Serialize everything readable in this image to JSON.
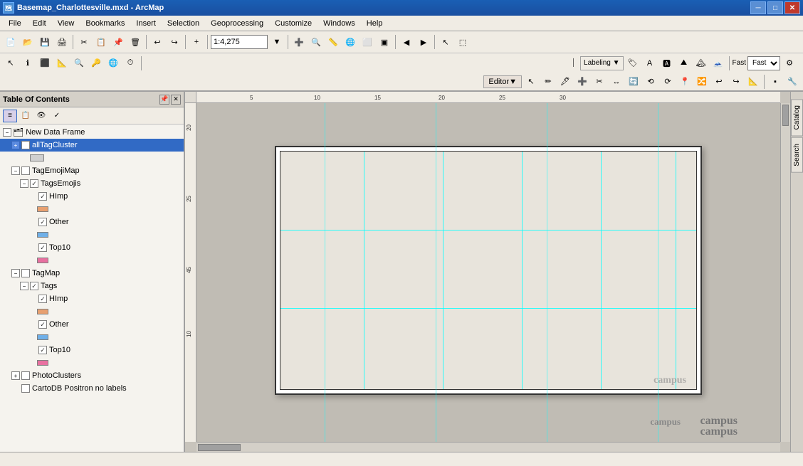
{
  "titleBar": {
    "title": "Basemap_Charlottesville.mxd - ArcMap",
    "minBtn": "─",
    "maxBtn": "□",
    "closeBtn": "✕"
  },
  "menuBar": {
    "items": [
      "File",
      "Edit",
      "View",
      "Bookmarks",
      "Insert",
      "Selection",
      "Geoprocessing",
      "Customize",
      "Windows",
      "Help"
    ]
  },
  "toolbar1": {
    "scaleValue": "1:4,275",
    "scalePlaceholder": "1:4,275"
  },
  "toolbar2": {
    "labelingBtn": "Labeling ▼",
    "fastLabel": "Fast",
    "editorLabel": "Editor▼"
  },
  "toc": {
    "title": "Table Of Contents",
    "layers": [
      {
        "id": "newDataFrame",
        "label": "New Data Frame",
        "indent": 0,
        "type": "group",
        "expanded": true,
        "checked": null,
        "hasExpand": true
      },
      {
        "id": "allTagCluster",
        "label": "allTagCluster",
        "indent": 1,
        "type": "layer",
        "expanded": false,
        "checked": false,
        "selected": true,
        "hasExpand": true
      },
      {
        "id": "allTagCluster-swatch",
        "label": "",
        "indent": 2,
        "type": "swatch",
        "hasExpand": false
      },
      {
        "id": "tagEmojiMap",
        "label": "TagEmojiMap",
        "indent": 1,
        "type": "layer",
        "expanded": true,
        "checked": false,
        "hasExpand": true
      },
      {
        "id": "tagsEmojis",
        "label": "TagsEmojis",
        "indent": 2,
        "type": "layer",
        "expanded": true,
        "checked": true,
        "hasExpand": true
      },
      {
        "id": "hlmp1",
        "label": "HImp",
        "indent": 3,
        "type": "sublayer",
        "checked": true,
        "hasExpand": false
      },
      {
        "id": "other1",
        "label": "Other",
        "indent": 3,
        "type": "sublayer",
        "checked": true,
        "hasExpand": false
      },
      {
        "id": "top10-1",
        "label": "Top10",
        "indent": 3,
        "type": "sublayer",
        "checked": true,
        "hasExpand": false
      },
      {
        "id": "tagMap",
        "label": "TagMap",
        "indent": 1,
        "type": "layer",
        "expanded": true,
        "checked": false,
        "hasExpand": true
      },
      {
        "id": "tags",
        "label": "Tags",
        "indent": 2,
        "type": "layer",
        "expanded": true,
        "checked": true,
        "hasExpand": true
      },
      {
        "id": "hlmp2",
        "label": "HImp",
        "indent": 3,
        "type": "sublayer",
        "checked": true,
        "hasExpand": false
      },
      {
        "id": "other2",
        "label": "Other",
        "indent": 3,
        "type": "sublayer",
        "checked": true,
        "hasExpand": false
      },
      {
        "id": "top10-2",
        "label": "Top10",
        "indent": 3,
        "type": "sublayer",
        "checked": true,
        "hasExpand": false
      },
      {
        "id": "photoClusters",
        "label": "PhotoClusters",
        "indent": 1,
        "type": "layer",
        "expanded": false,
        "checked": false,
        "hasExpand": true
      },
      {
        "id": "cartoDb",
        "label": "CartoDB Positron no labels",
        "indent": 1,
        "type": "layer",
        "expanded": false,
        "checked": false,
        "hasExpand": false
      }
    ]
  },
  "rulerTicks": {
    "horizontal": [
      "5",
      "10",
      "15",
      "20",
      "25",
      "30"
    ],
    "vertical": [
      "20",
      "25",
      "45",
      "10"
    ]
  },
  "sideTabs": [
    "Catalog",
    "Search"
  ],
  "mapText": {
    "campus": "campus"
  }
}
